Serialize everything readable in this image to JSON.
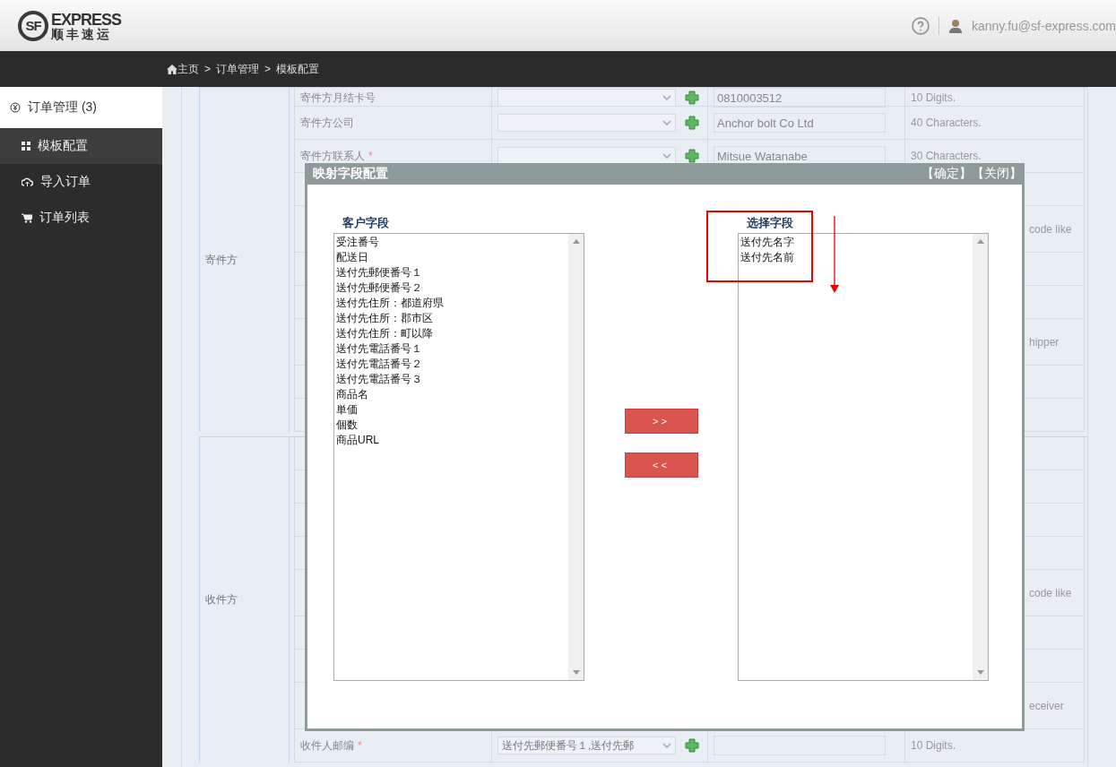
{
  "header": {
    "logo": {
      "mark": "SF",
      "wordmark": "EXPRESS",
      "tagline": "顺丰速运"
    },
    "user": "kanny.fu@sf-express.com"
  },
  "breadcrumb": {
    "separator": ">",
    "items": [
      "主页",
      "订单管理",
      "模板配置"
    ]
  },
  "sidebar": {
    "items": [
      {
        "kind": "group",
        "label": "订单管理 (3)"
      },
      {
        "kind": "item",
        "label": "模板配置",
        "selected": true
      },
      {
        "kind": "item",
        "label": "导入订单",
        "selected": false
      },
      {
        "kind": "item",
        "label": "订单列表",
        "selected": false
      }
    ]
  },
  "form": {
    "groups": [
      {
        "label": "寄件方",
        "rows": [
          {
            "kind": "field",
            "label": "寄件方月结卡号",
            "value": "0810003512",
            "note": "10 Digits."
          },
          {
            "kind": "field",
            "label": "寄件方公司",
            "value": "Anchor bolt Co Ltd",
            "note": "40 Characters."
          },
          {
            "kind": "field",
            "label": "寄件方联系人",
            "required_mark": "*",
            "value": "Mitsue Watanabe",
            "note": "30 Characters."
          },
          {
            "kind": "covered"
          },
          {
            "kind": "covered",
            "note": "code like"
          },
          {
            "kind": "covered"
          },
          {
            "kind": "covered"
          },
          {
            "kind": "covered",
            "note": "hipper"
          },
          {
            "kind": "covered"
          },
          {
            "kind": "covered"
          }
        ]
      },
      {
        "label": "收件方",
        "rows": [
          {
            "kind": "covered"
          },
          {
            "kind": "covered"
          },
          {
            "kind": "covered"
          },
          {
            "kind": "covered"
          },
          {
            "kind": "covered",
            "note": "code like"
          },
          {
            "kind": "covered"
          },
          {
            "kind": "covered"
          },
          {
            "kind": "covered",
            "note": "eceiver"
          },
          {
            "kind": "field",
            "label": "收件人邮编",
            "required_mark": "*",
            "selection": "送付先郵便番号１,送付先郵",
            "note": "10 Digits."
          }
        ]
      }
    ]
  },
  "modal": {
    "title": "映射字段配置",
    "actions": [
      "【确定】",
      "【关闭】"
    ],
    "source": {
      "heading": "客户字段",
      "items": [
        "受注番号",
        "配送日",
        "送付先郵便番号１",
        "送付先郵便番号２",
        "送付先住所：都道府県",
        "送付先住所：郡市区",
        "送付先住所：町以降",
        "送付先電話番号１",
        "送付先電話番号２",
        "送付先電話番号３",
        "商品名",
        "単価",
        "個数",
        "商品URL"
      ]
    },
    "buttons": [
      ">>",
      "<<"
    ],
    "target": {
      "heading": "选择字段",
      "items": [
        "送付先名字",
        "送付先名前"
      ]
    }
  }
}
